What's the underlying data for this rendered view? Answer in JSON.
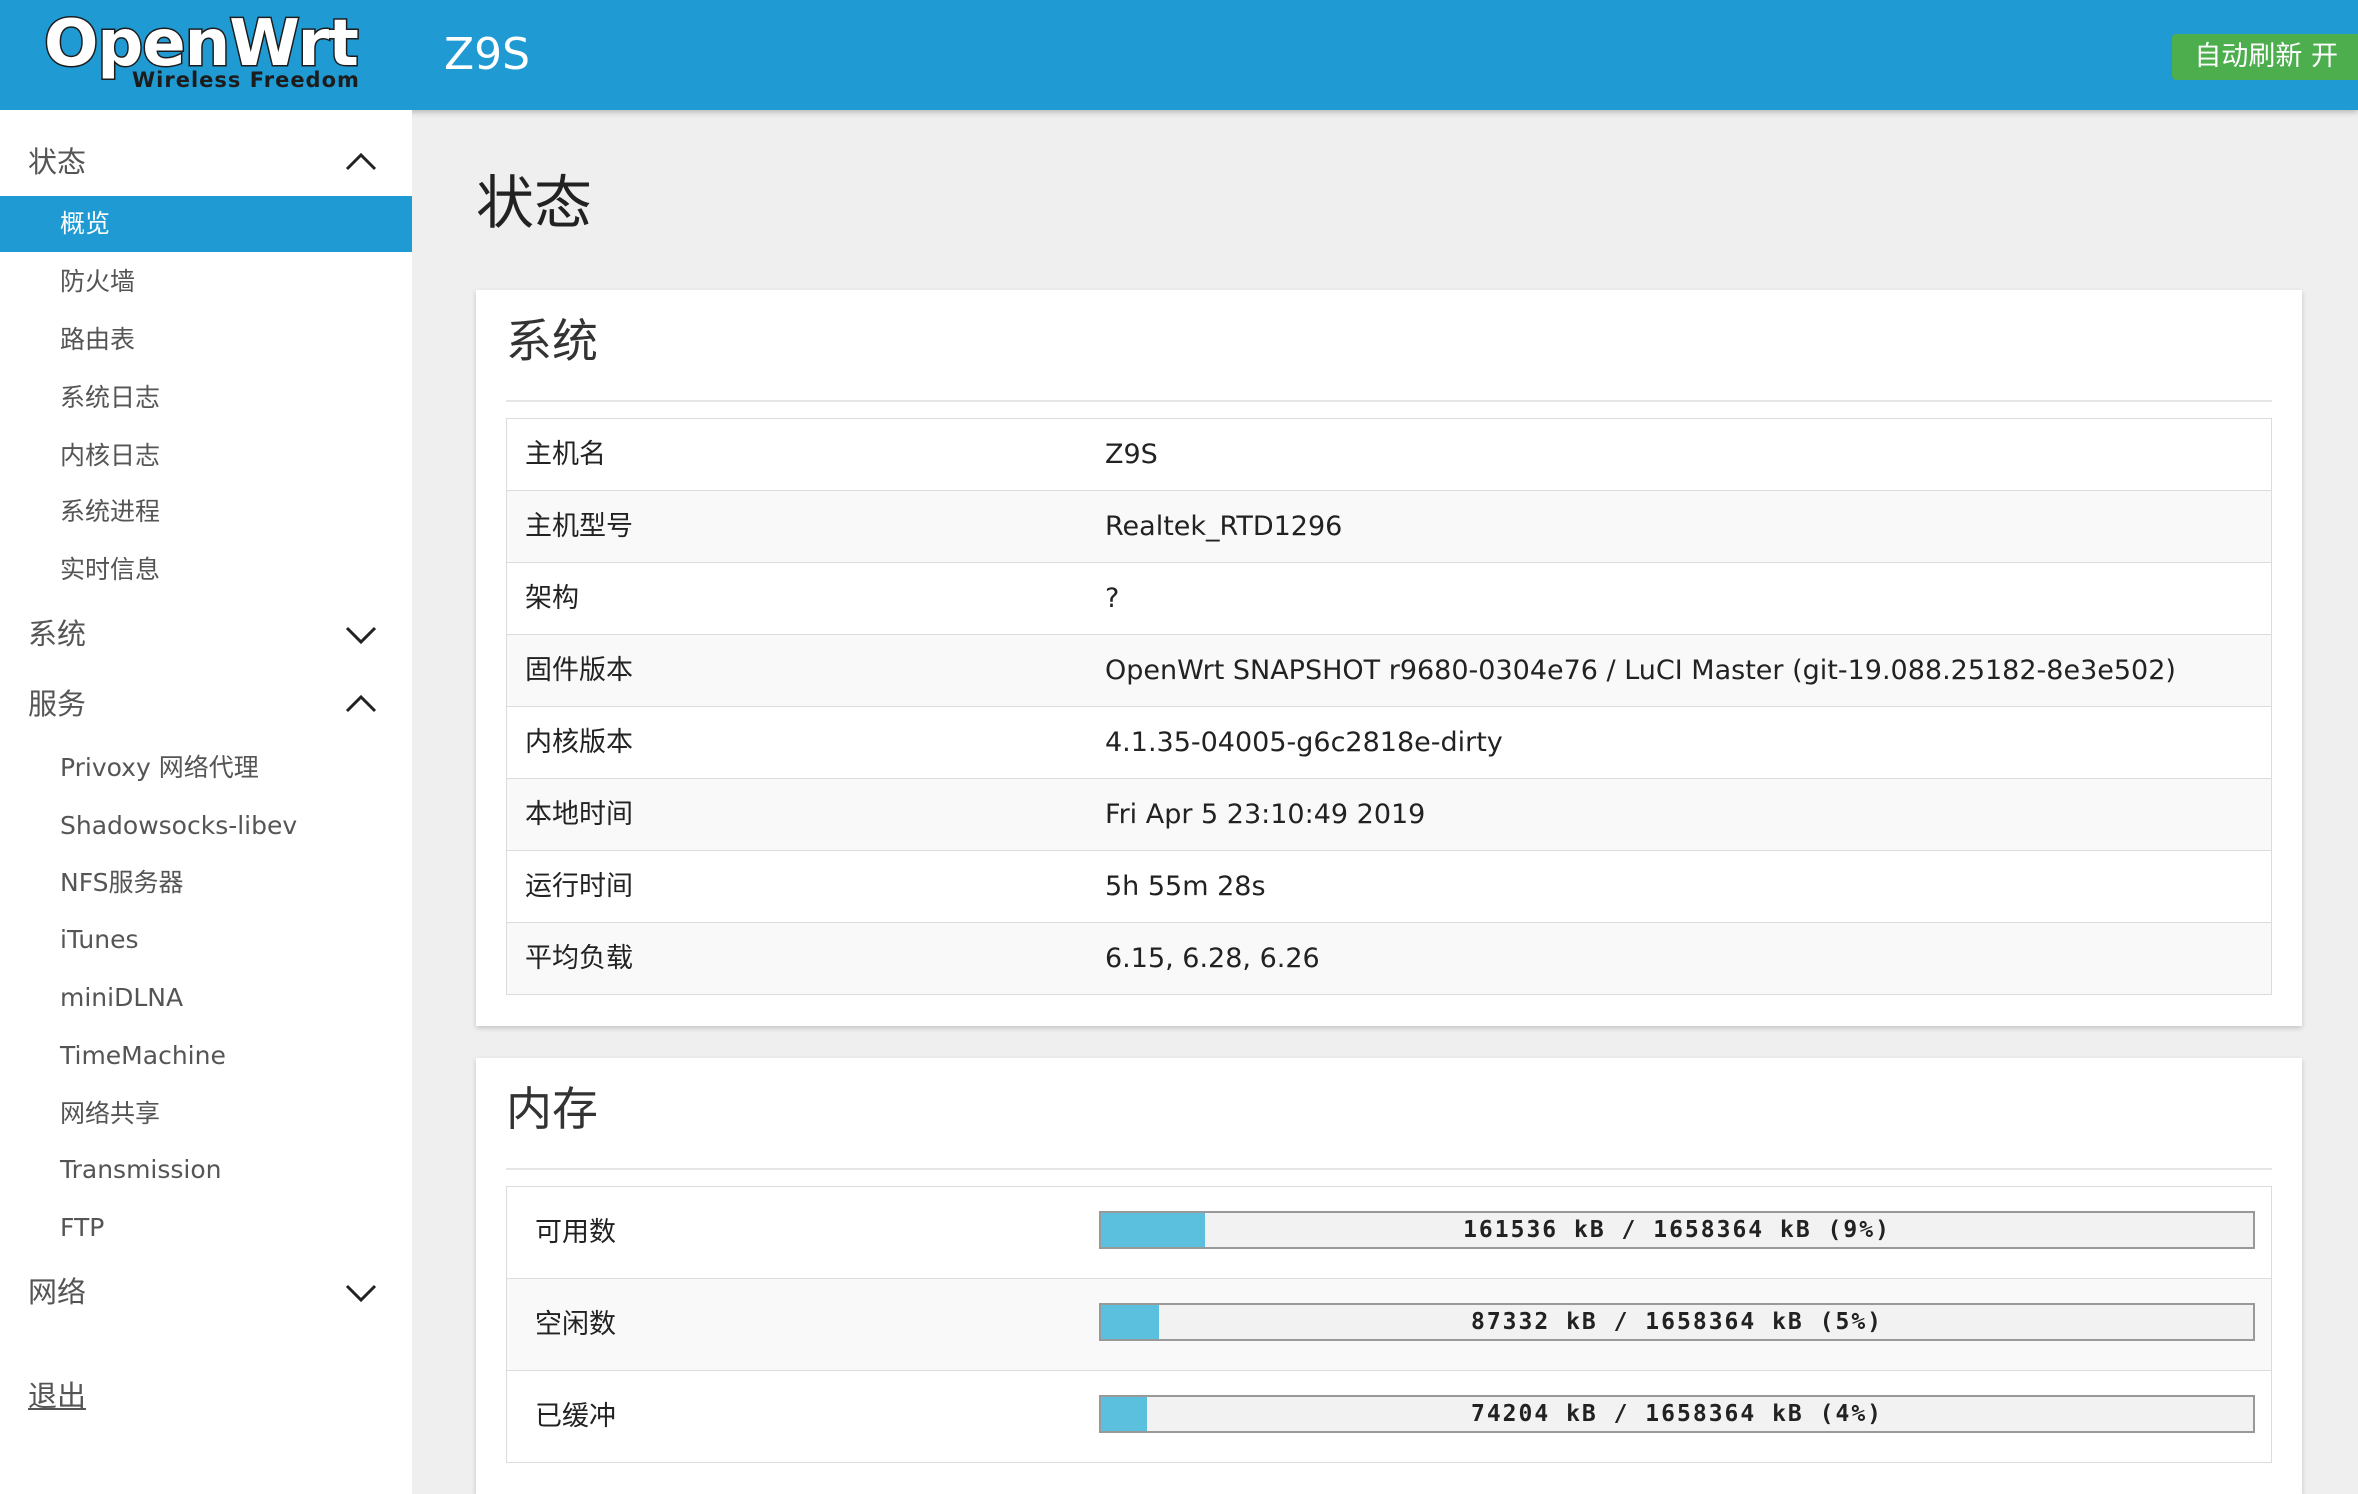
{
  "header": {
    "logo_text": "OpenWrt",
    "logo_subtext": "Wireless Freedom",
    "hostname": "Z9S",
    "refresh_label": "自动刷新 开",
    "colors": {
      "header_bg": "#1f9ad3",
      "refresh_bg": "#4cae4c"
    }
  },
  "sidebar": {
    "status": {
      "label": "状态",
      "expanded": true,
      "items": [
        "概览",
        "防火墙",
        "路由表",
        "系统日志",
        "内核日志",
        "系统进程",
        "实时信息"
      ],
      "active_index": 0
    },
    "system": {
      "label": "系统",
      "expanded": false
    },
    "services": {
      "label": "服务",
      "expanded": true,
      "items": [
        "Privoxy 网络代理",
        "Shadowsocks-libev",
        "NFS服务器",
        "iTunes",
        "miniDLNA",
        "TimeMachine",
        "网络共享",
        "Transmission",
        "FTP"
      ]
    },
    "network": {
      "label": "网络",
      "expanded": false
    },
    "logout": "退出"
  },
  "main": {
    "title": "状态",
    "system_card": {
      "title": "系统",
      "rows": [
        {
          "key": "主机名",
          "value": "Z9S"
        },
        {
          "key": "主机型号",
          "value": "Realtek_RTD1296"
        },
        {
          "key": "架构",
          "value": "?"
        },
        {
          "key": "固件版本",
          "value": "OpenWrt SNAPSHOT r9680-0304e76 / LuCI Master (git-19.088.25182-8e3e502)"
        },
        {
          "key": "内核版本",
          "value": "4.1.35-04005-g6c2818e-dirty"
        },
        {
          "key": "本地时间",
          "value": "Fri Apr 5 23:10:49 2019"
        },
        {
          "key": "运行时间",
          "value": "5h 55m 28s"
        },
        {
          "key": "平均负载",
          "value": "6.15, 6.28, 6.26"
        }
      ]
    },
    "memory_card": {
      "title": "内存",
      "rows": [
        {
          "key": "可用数",
          "text": "161536 kB / 1658364 kB (9%)",
          "percent": 9
        },
        {
          "key": "空闲数",
          "text": "87332 kB / 1658364 kB (5%)",
          "percent": 5
        },
        {
          "key": "已缓冲",
          "text": "74204 kB / 1658364 kB (4%)",
          "percent": 4
        }
      ]
    }
  }
}
